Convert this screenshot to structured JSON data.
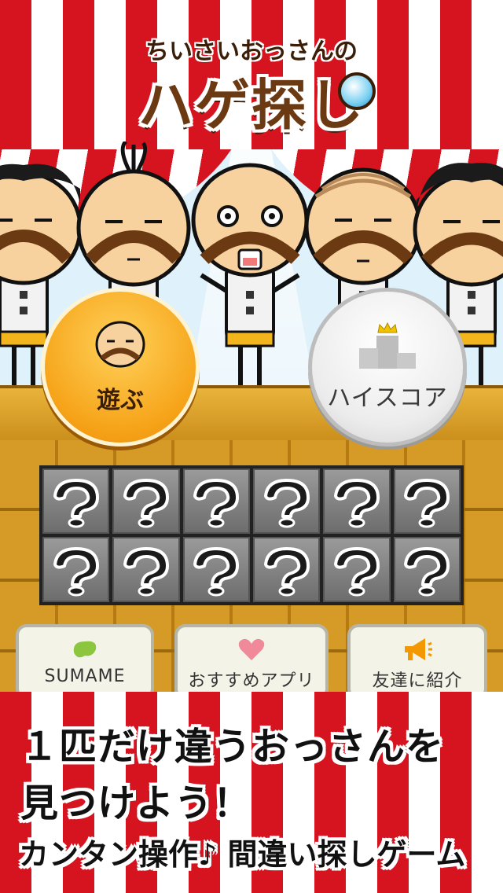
{
  "title": {
    "sub": "ちいさいおっさんの",
    "main": "ハゲ探し"
  },
  "buttons": {
    "play": "遊ぶ",
    "highscore": "ハイスコア"
  },
  "cards": {
    "count": 12,
    "icon": "question-mark-icon"
  },
  "panels": [
    {
      "label": "SUMAME",
      "icon": "bean-icon",
      "color": "#8cc63f"
    },
    {
      "label": "おすすめアプリ",
      "icon": "heart-icon",
      "color": "#f08a9a"
    },
    {
      "label": "友達に紹介",
      "icon": "megaphone-icon",
      "color": "#f39800"
    }
  ],
  "promo": {
    "line1": "１匹だけ違うおっさんを",
    "line2": "見つけよう！",
    "line3": "カンタン操作♪ 間違い探しゲーム"
  },
  "colors": {
    "tent_red": "#d6141f",
    "stage_gold": "#e9b43b",
    "play_orange": "#f6a318",
    "title_brown": "#6b3a12"
  }
}
